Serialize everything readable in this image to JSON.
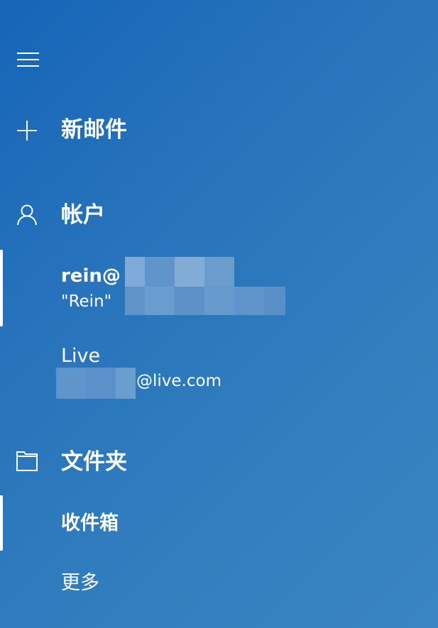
{
  "nav": {
    "menu_icon": "hamburger-icon"
  },
  "new_mail": {
    "icon": "plus-icon",
    "label": "新邮件"
  },
  "accounts": {
    "icon": "person-icon",
    "label": "帐户",
    "items": [
      {
        "name": "rein@",
        "sub": "\"Rein\"",
        "selected": true
      },
      {
        "name": "Live",
        "sub": "@live.com",
        "selected": false
      }
    ]
  },
  "folders": {
    "icon": "folder-icon",
    "label": "文件夹",
    "items": [
      {
        "label": "收件箱",
        "selected": true
      },
      {
        "label": "更多",
        "selected": false
      }
    ]
  },
  "colors": {
    "background_start": "#1565b8",
    "background_end": "#3a84c2",
    "text": "#ffffff"
  }
}
